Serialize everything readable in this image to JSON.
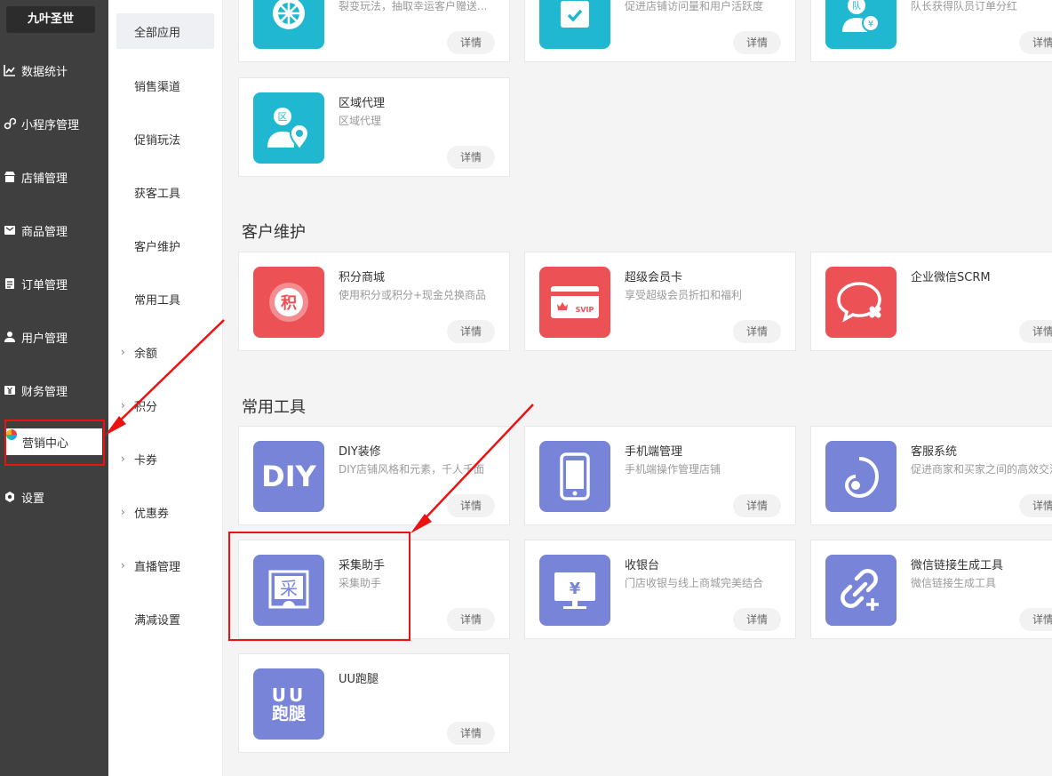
{
  "brand": {
    "name": "九叶圣世"
  },
  "nav": {
    "items": [
      {
        "label": "数据统计",
        "icon": "chart-icon"
      },
      {
        "label": "小程序管理",
        "icon": "mini-program-icon"
      },
      {
        "label": "店铺管理",
        "icon": "store-icon"
      },
      {
        "label": "商品管理",
        "icon": "goods-icon"
      },
      {
        "label": "订单管理",
        "icon": "order-icon"
      },
      {
        "label": "用户管理",
        "icon": "user-icon"
      },
      {
        "label": "财务管理",
        "icon": "finance-icon"
      },
      {
        "label": "营销中心",
        "icon": "marketing-icon",
        "active": true
      },
      {
        "label": "设置",
        "icon": "settings-icon"
      }
    ]
  },
  "subnav": {
    "items": [
      {
        "label": "全部应用",
        "active": true
      },
      {
        "label": "销售渠道"
      },
      {
        "label": "促销玩法"
      },
      {
        "label": "获客工具"
      },
      {
        "label": "客户维护"
      },
      {
        "label": "常用工具"
      },
      {
        "label": "余额",
        "expandable": true
      },
      {
        "label": "积分",
        "expandable": true
      },
      {
        "label": "卡券",
        "expandable": true
      },
      {
        "label": "优惠券",
        "expandable": true
      },
      {
        "label": "直播管理",
        "expandable": true
      },
      {
        "label": "满减设置"
      }
    ]
  },
  "detail_label": "详情",
  "top_cards": [
    {
      "desc": "裂变玩法，抽取幸运客户赠送...",
      "icon": "wheel-icon",
      "color": "#1fb8d0"
    },
    {
      "desc": "促进店铺访问量和用户活跃度",
      "icon": "calendar-check-icon",
      "color": "#1fb8d0"
    },
    {
      "desc": "队长获得队员订单分红",
      "icon": "team-dividend-icon",
      "color": "#1fb8d0"
    },
    {
      "name": "区域代理",
      "desc": "区域代理",
      "icon": "region-agent-icon",
      "color": "#1fb8d0"
    }
  ],
  "sections": [
    {
      "title": "客户维护",
      "cards": [
        {
          "name": "积分商城",
          "desc": "使用积分或积分+现金兑换商品",
          "icon": "points-mall-icon",
          "color": "#ec5156"
        },
        {
          "name": "超级会员卡",
          "desc": "享受超级会员折扣和福利",
          "icon": "svip-card-icon",
          "color": "#ec5156"
        },
        {
          "name": "企业微信SCRM",
          "desc": "",
          "icon": "wechat-scrm-icon",
          "color": "#ec5156"
        }
      ]
    },
    {
      "title": "常用工具",
      "cards": [
        {
          "name": "DIY装修",
          "desc": "DIY店铺风格和元素，千人千面",
          "icon": "diy-icon",
          "color": "#7784d8"
        },
        {
          "name": "手机端管理",
          "desc": "手机端操作管理店铺",
          "icon": "mobile-icon",
          "color": "#7784d8"
        },
        {
          "name": "客服系统",
          "desc": "促进商家和买家之间的高效交流",
          "icon": "customer-service-icon",
          "color": "#7784d8"
        },
        {
          "name": "采集助手",
          "desc": "采集助手",
          "icon": "collect-assistant-icon",
          "color": "#7784d8"
        },
        {
          "name": "收银台",
          "desc": "门店收银与线上商城完美结合",
          "icon": "cashier-icon",
          "color": "#7784d8"
        },
        {
          "name": "微信链接生成工具",
          "desc": "微信链接生成工具",
          "icon": "link-generator-icon",
          "color": "#7784d8"
        },
        {
          "name": "UU跑腿",
          "desc": "",
          "icon": "uu-errand-icon",
          "color": "#7784d8"
        }
      ]
    }
  ],
  "icon_text": {
    "points": "积",
    "svip": "SVIP",
    "diy": "DIY",
    "cashier": "¥",
    "collect": "采",
    "team": "队",
    "uu_top": "UU",
    "uu_bottom": "跑腿",
    "region": "区"
  },
  "annotation_color": "#ee1111"
}
